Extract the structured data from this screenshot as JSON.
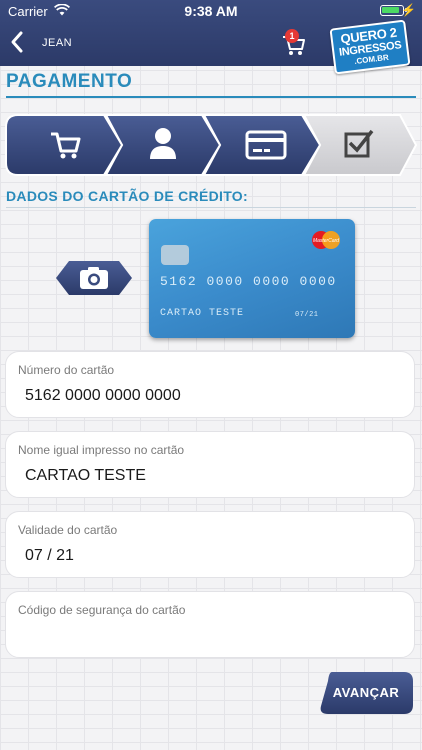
{
  "status_bar": {
    "carrier": "Carrier",
    "time": "9:38 AM"
  },
  "header": {
    "user_name": "JEAN",
    "cart_count": "1",
    "logo": {
      "line1": "QUERO 2",
      "line2": "INGRESSOS",
      "line3": ".COM.BR"
    }
  },
  "page": {
    "title": "PAGAMENTO",
    "subtitle": "DADOS DO CARTÃO DE CRÉDITO:"
  },
  "stepper": {
    "steps": [
      {
        "icon": "cart-icon",
        "active": true
      },
      {
        "icon": "user-icon",
        "active": true
      },
      {
        "icon": "credit-card-icon",
        "active": true
      },
      {
        "icon": "checkbox-icon",
        "active": false
      }
    ]
  },
  "card_preview": {
    "brand": "MasterCard",
    "number": "5162 0000 0000 0000",
    "holder": "CARTAO TESTE",
    "expiry": "07/21"
  },
  "form": {
    "card_number": {
      "label": "Número do cartão",
      "value": "5162 0000 0000 0000"
    },
    "name": {
      "label": "Nome igual impresso no cartão",
      "value": "CARTAO TESTE"
    },
    "expiry": {
      "label": "Validade do cartão",
      "value": "07 / 21"
    },
    "cvv": {
      "label": "Código de segurança do cartão",
      "value": ""
    }
  },
  "buttons": {
    "advance": "AVANÇAR"
  },
  "colors": {
    "header": "#2c3a68",
    "accent": "#2a8bbb",
    "step_active": "#34467c",
    "step_inactive": "#d7d7da",
    "card": "#3b8ccc"
  }
}
